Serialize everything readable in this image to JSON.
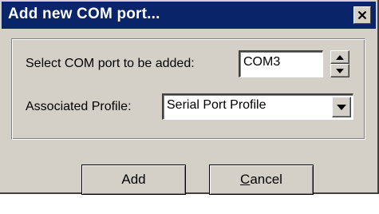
{
  "dialog": {
    "title": "Add new COM port...",
    "close_icon": "close-icon"
  },
  "port": {
    "label": "Select COM port to be added:",
    "value": "COM3",
    "spin_up_icon": "spin-up-icon",
    "spin_down_icon": "spin-down-icon"
  },
  "profile": {
    "label": "Associated Profile:",
    "value": "Serial Port Profile",
    "dropdown_icon": "dropdown-arrow-icon"
  },
  "buttons": {
    "add_label": "Add",
    "cancel_first": "C",
    "cancel_rest": "ancel"
  }
}
